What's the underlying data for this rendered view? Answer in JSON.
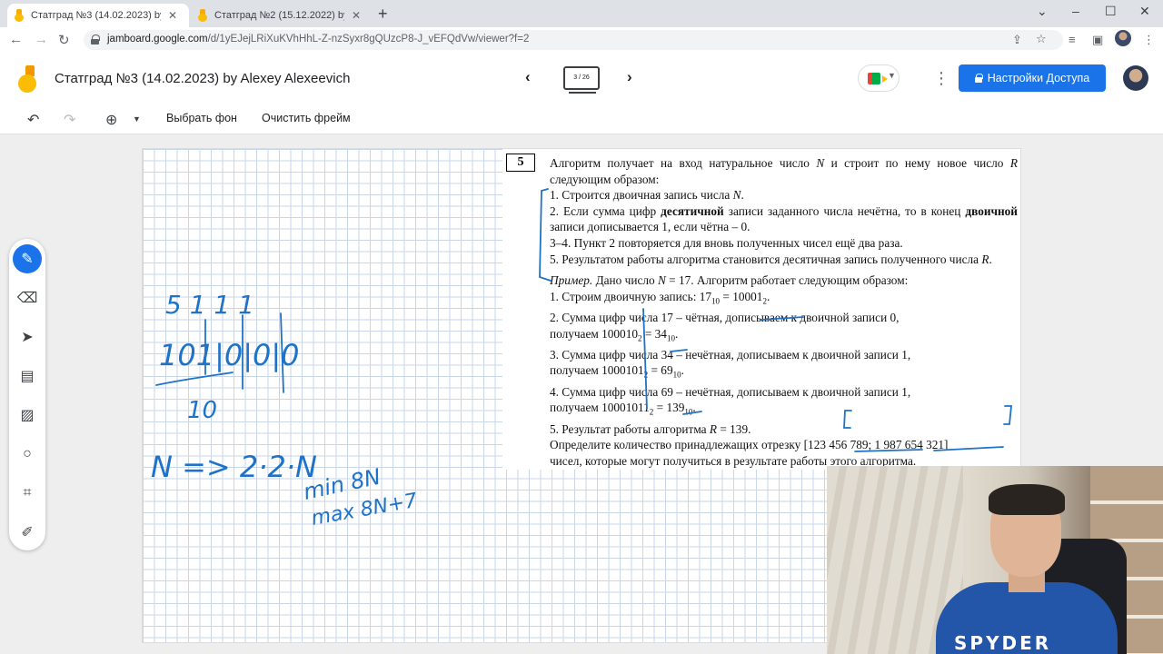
{
  "browser": {
    "tabs": [
      {
        "title": "Статград №3 (14.02.2023) by Alex",
        "active": true
      },
      {
        "title": "Статград №2 (15.12.2022) by Alex",
        "active": false
      }
    ],
    "url_host": "jamboard.google.com",
    "url_path": "/d/1yEJejLRiXuKVhHhL-Z-nzSyxr8gQUzcP8-J_vEFQdVw/viewer?f=2"
  },
  "jamboard": {
    "title": "Статград №3 (14.02.2023) by Alexey Alexeevich",
    "frame_counter": "3 / 26",
    "share_label": "Настройки Доступа",
    "toolbar": {
      "background_label": "Выбрать фон",
      "clear_label": "Очистить фрейм"
    },
    "accent_color": "#1a73e8"
  },
  "task": {
    "number": "5",
    "intro_a": "Алгоритм получает на вход натуральное число ",
    "intro_b": " и строит по нему новое число ",
    "intro_c": " следующим образом:",
    "N": "N",
    "R": "R",
    "step1": "1. Строится двоичная запись числа ",
    "step2_a": "2. Если сумма цифр ",
    "step2_bold1": "десятичной",
    "step2_b": " записи заданного числа нечётна, то в конец ",
    "step2_bold2": "двоичной",
    "step2_c": " записи дописывается 1, если чётна – 0.",
    "step34": "3–4. Пункт 2 повторяется для вновь полученных чисел ещё два раза.",
    "step5": "5. Результатом работы алгоритма становится десятичная запись полученного числа ",
    "example_label": "Пример.",
    "example_a": " Дано число ",
    "example_b": " = 17. Алгоритм работает следующим образом:",
    "ex1_a": "1.  Строим двоичную запись: 17",
    "ex1_b": " = 10001",
    "ex2_a": "2.  Сумма цифр числа 17 – чётная, дописываем к двоичной записи 0,",
    "ex2_b": "получаем 100010",
    "ex2_c": " = 34",
    "ex3_a": "3.  Сумма цифр числа 34 – нечётная, дописываем к двоичной записи 1,",
    "ex3_b": "получаем 1000101",
    "ex3_c": " = 69",
    "ex4_a": "4.  Сумма цифр числа 69 – нечётная, дописываем к двоичной записи 1,",
    "ex4_b": "получаем 10001011",
    "ex4_c": " = 139",
    "ex5_a": "5.  Результат работы алгоритма ",
    "ex5_b": " = 139.",
    "q_a": "Определите количество принадлежащих отрезку [123 456 789; 1 987 654 321]",
    "q_b": "чисел, которые могут получиться в результате работы этого алгоритма.",
    "sub10": "10",
    "sub2": "2"
  },
  "handwriting": {
    "top_digits": "5  1  1  1",
    "binary": "101|0|0|0",
    "under": "10",
    "formula": "N => 2·2·N",
    "min_label": "min 8N",
    "max_label": "max 8N+7"
  },
  "webcam": {
    "shirt_logo": "SPYDER"
  }
}
